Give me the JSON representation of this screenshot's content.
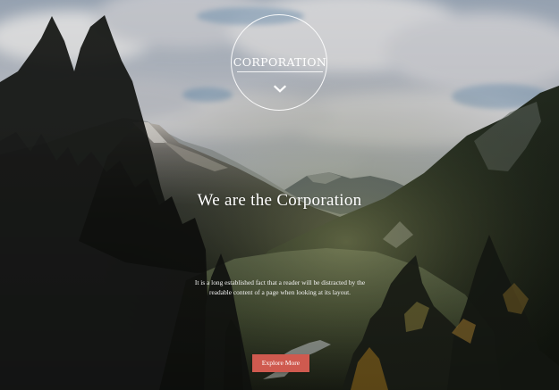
{
  "logo": {
    "text": "CORPORATION",
    "icon": "chevron-down-icon"
  },
  "hero": {
    "headline": "We are the Corporation",
    "description": "It is a long established fact that a reader will be distracted by the readable content of a page when looking at its layout.",
    "background": "mountain-valley-photo"
  },
  "cta": {
    "label": "Explore More"
  },
  "colors": {
    "button": "#cf5a4f",
    "text": "#ffffff",
    "sky": "#9fb8c8",
    "forest": "#1f2a19"
  }
}
